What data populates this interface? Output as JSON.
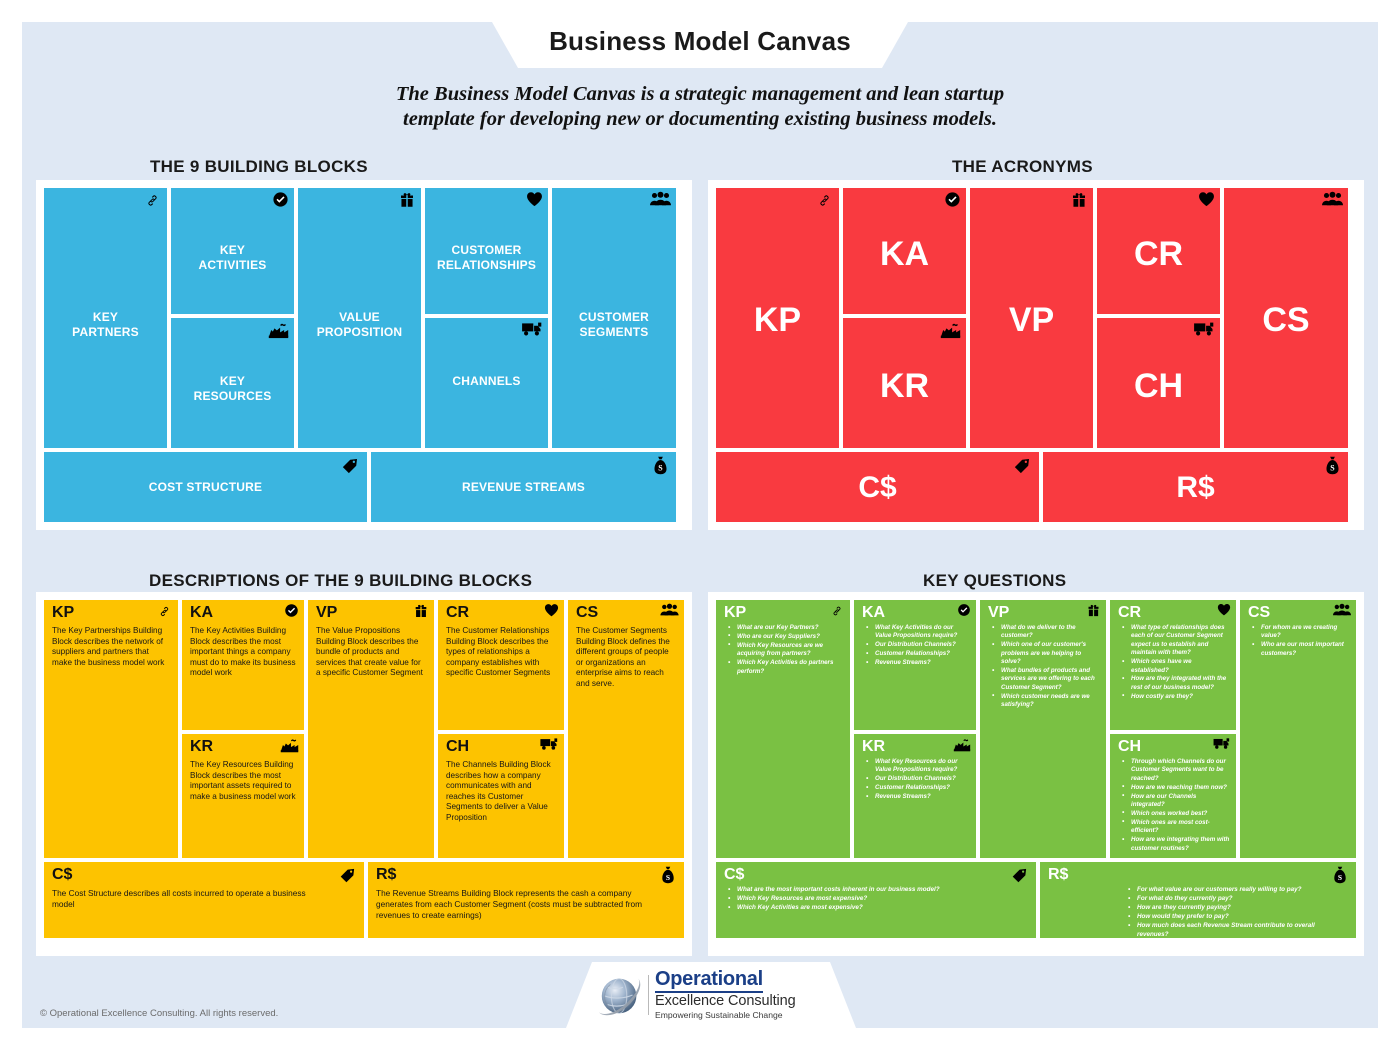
{
  "header": {
    "title": "Business Model Canvas",
    "subtitle_line1": "The Business Model Canvas is a strategic management and lean startup",
    "subtitle_line2": "template for developing new or documenting existing business models."
  },
  "sections": {
    "building_blocks": "THE 9 BUILDING BLOCKS",
    "acronyms": "THE ACRONYMS",
    "descriptions": "DESCRIPTIONS OF THE 9 BUILDING BLOCKS",
    "key_questions": "KEY QUESTIONS"
  },
  "colors": {
    "canvas_bg": "#dfe8f4",
    "blue": "#3bb5e0",
    "red": "#f93a40",
    "yellow": "#fdc300",
    "green": "#7ac143",
    "panel": "#ffffff"
  },
  "blocks": {
    "key_partners": {
      "label": "KEY\nPARTNERS",
      "icon": "link-icon"
    },
    "key_activities": {
      "label": "KEY\nACTIVITIES",
      "icon": "check-circle-icon"
    },
    "key_resources": {
      "label": "KEY\nRESOURCES",
      "icon": "factory-icon"
    },
    "value_proposition": {
      "label": "VALUE\nPROPOSITION",
      "icon": "gift-icon"
    },
    "customer_relationships": {
      "label": "CUSTOMER\nRELATIONSHIPS",
      "icon": "heart-icon"
    },
    "channels": {
      "label": "CHANNELS",
      "icon": "truck-icon"
    },
    "customer_segments": {
      "label": "CUSTOMER\nSEGMENTS",
      "icon": "people-icon"
    },
    "cost_structure": {
      "label": "COST STRUCTURE",
      "icon": "price-tag-icon"
    },
    "revenue_streams": {
      "label": "REVENUE STREAMS",
      "icon": "money-bag-icon"
    }
  },
  "acronyms": {
    "kp": "KP",
    "ka": "KA",
    "kr": "KR",
    "vp": "VP",
    "cr": "CR",
    "ch": "CH",
    "cs": "CS",
    "cost": "C$",
    "revenue": "R$"
  },
  "descriptions": {
    "kp": {
      "code": "KP",
      "text": "The Key Partnerships Building Block describes the network of suppliers and partners that make the business model work"
    },
    "ka": {
      "code": "KA",
      "text": "The Key Activities Building Block describes the most important things a company must do to make its business model work"
    },
    "kr": {
      "code": "KR",
      "text": "The Key Resources Building Block describes the most important assets required to make a business model work"
    },
    "vp": {
      "code": "VP",
      "text": "The Value Propositions Building Block describes the bundle of products and services that create value for a specific Customer Segment"
    },
    "cr": {
      "code": "CR",
      "text": "The Customer Relationships Building Block describes the types of relationships a company establishes with specific Customer Segments"
    },
    "ch": {
      "code": "CH",
      "text": "The Channels Building Block describes how a company communicates with and reaches its Customer Segments to deliver a Value Proposition"
    },
    "cs": {
      "code": "CS",
      "text": "The Customer Segments Building Block defines the different groups of people or organizations an enterprise aims to reach and serve."
    },
    "cost": {
      "code": "C$",
      "text": "The Cost Structure describes all costs incurred to operate a business model"
    },
    "revenue": {
      "code": "R$",
      "text": "The Revenue Streams Building Block represents the cash a company generates from each Customer Segment (costs must be subtracted from revenues to create earnings)"
    }
  },
  "questions": {
    "kp": {
      "code": "KP",
      "items": [
        "What are our Key Partners?",
        "Who are our Key Suppliers?",
        "Which Key Resources are we acquiring from partners?",
        "Which Key Activities do partners perform?"
      ]
    },
    "ka": {
      "code": "KA",
      "items": [
        "What Key Activities do our Value Propositions require?",
        "Our Distribution Channels?",
        "Customer Relationships?",
        "Revenue Streams?"
      ]
    },
    "kr": {
      "code": "KR",
      "items": [
        "What Key Resources do our Value Propositions require?",
        "Our Distribution Channels?",
        "Customer Relationships?",
        "Revenue Streams?"
      ]
    },
    "vp": {
      "code": "VP",
      "items": [
        "What do we deliver to the customer?",
        "Which one of our customer's problems are we helping to solve?",
        "What bundles of products and services are we offering to each Customer Segment?",
        "Which customer needs are we satisfying?"
      ]
    },
    "cr": {
      "code": "CR",
      "items": [
        "What type of relationships does each of our Customer Segment expect us to establish and maintain with them?",
        "Which ones have we established?",
        "How are they integrated with the rest of our business model?",
        "How costly are they?"
      ]
    },
    "ch": {
      "code": "CH",
      "items": [
        "Through which Channels do our Customer Segments want to be reached?",
        "How are we reaching them now?",
        "How are our Channels integrated?",
        "Which ones worked best?",
        "Which ones are most cost-efficient?",
        "How are we integrating them with customer routines?"
      ]
    },
    "cs": {
      "code": "CS",
      "items": [
        "For whom are we creating value?",
        "Who are our most important customers?"
      ]
    },
    "cost": {
      "code": "C$",
      "items": [
        "What are the most important costs inherent in our business model?",
        "Which Key Resources are most expensive?",
        "Which Key Activities are most expensive?"
      ]
    },
    "revenue": {
      "code": "R$",
      "items": [
        "For what value are our customers really willing to pay?",
        "For what do they currently pay?",
        "How are they currently paying?",
        "How would they prefer to pay?",
        "How much does each Revenue Stream contribute to overall revenues?"
      ]
    }
  },
  "footer": {
    "logo_line1": "Operational",
    "logo_line2": "Excellence Consulting",
    "logo_line3": "Empowering Sustainable Change",
    "copyright": "© Operational Excellence Consulting. All rights reserved."
  }
}
